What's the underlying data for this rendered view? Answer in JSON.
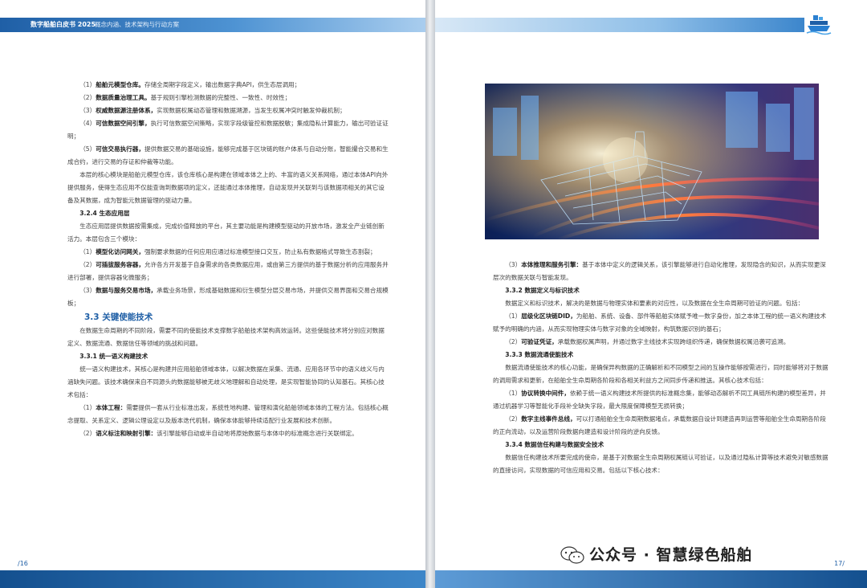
{
  "header": {
    "book_title": "数字船舶白皮书 2025",
    "chapter_title": "概念内涵、技术架构与行动方案"
  },
  "left_page": {
    "page_number": "16",
    "paragraphs": [
      {
        "num": "（1）",
        "bold": "船舶元模型仓库。",
        "text": "存储全周期字段定义，输出数据字典API，供生态层调用；"
      },
      {
        "num": "（2）",
        "bold": "数据质量治理工具。",
        "text": "基于规则引擎检测数据的完整性、一致性、时效性；"
      },
      {
        "num": "（3）",
        "bold": "权威数据源注册体系，",
        "text": "实现数据权属动态管理和数据溯源，当发生权属冲突时触发仲裁机制；"
      },
      {
        "num": "（4）",
        "bold": "可信数据空间引擎，",
        "text": "执行可信数据空间策略，实现字段级管控和数据脱敏；集成隐私计算能力，输出可验证证明；"
      },
      {
        "num": "（5）",
        "bold": "可信交易执行器，",
        "text": "提供数据交易的基础设施，能够完成基于区块链的账户体系与自动分账，智能撮合交易和生成合约，进行交易的存证和仲裁等功能。"
      }
    ],
    "core_module_para": "本层的核心模块是船舶元模型仓库，该仓库核心是构建在领域本体之上的、丰富的语义关系网络，通过本体API向外提供服务，使得生态应用不仅能查询到数据项的定义，还能通过本体推理，自动发现并关联到与该数据项相关的其它设备及其数据，成为智能元数据管理的驱动力量。",
    "s324_title": "3.2.4 生态应用层",
    "s324_intro": "生态应用层提供数据按需集成，完成价值释放的平台，其主要功能是构建模型驱动的开放市场，激发全产业链创新活力。本层包含三个模块：",
    "s324_items": [
      {
        "num": "（1）",
        "bold": "模型化访问网关，",
        "text": "强制要求数据的任何应用应通过标准模型接口交互，防止私有数据格式导致生态割裂；"
      },
      {
        "num": "（2）",
        "bold": "可插拔服务容器，",
        "text": "允许各方开发基于自身需求的各类数据应用，或由第三方提供的基于数据分析的应用服务并进行部署，提供容器化微服务；"
      },
      {
        "num": "（3）",
        "bold": "数据与服务交易市场，",
        "text": "承载业务场景，形成基础数据和衍生模型分层交易市场，并提供交易界面和交易合规模板；"
      }
    ],
    "s33_title": "3.3 关键使能技术",
    "s33_intro": "在数据生命周期的不同阶段，需要不同的使能技术支撑数字船舶技术架构高效运转。这些使能技术将分别应对数据定义、数据流通、数据信任等领域的挑战和问题。",
    "s331_title": "3.3.1 统一语义构建技术",
    "s331_intro": "统一语义构建技术，其核心是构建并应用船舶领域本体，以解决数据在采集、流通、应用各环节中的语义歧义与内涵缺失问题。该技术确保来自不同源头的数据能够被无歧义地理解和自动处理，是实现智能协同的认知基石。其核心技术包括：",
    "s331_items": [
      {
        "num": "（1）",
        "bold": "本体工程：",
        "text": "需要提供一套从行业标准出发，系统性地构建、管理和演化船舶领域本体的工程方法。包括核心概念提取、关系定义、逻辑公理设定以及版本迭代机制，确保本体能够持续适配行业发展和技术创新。"
      },
      {
        "num": "（2）",
        "bold": "语义标注和映射引擎：",
        "text": "该引擎能够自动或半自动地将原始数据与本体中的标准概念进行关联绑定。"
      }
    ]
  },
  "right_page": {
    "page_number": "17",
    "item3": {
      "num": "（3）",
      "bold": "本体推理和服务引擎：",
      "text": "基于本体中定义的逻辑关系，该引擎能够进行自动化推理，发现隐含的知识，从而实现更深层次的数据关联与智能发现。"
    },
    "s332_title": "3.3.2 数据定义与标识技术",
    "s332_intro": "数据定义和标识技术，解决的是数据与物理实体和要素的对应性，以及数据在全生命周期可验证的问题。包括：",
    "s332_items": [
      {
        "num": "（1）",
        "bold": "层级化区块链DID，",
        "text": "为船舶、系统、设备、部件等船舶实体赋予唯一数字身份，加之本体工程的统一语义构建技术赋予的明确的内涵，从而实现物理实体与数字对象的全域映射，构筑数据识别的基石；"
      },
      {
        "num": "（2）",
        "bold": "可验证凭证，",
        "text": "承载数据权属声明，并通过数字主线技术实现跨组织传递，确保数据权属沿袭可追溯。"
      }
    ],
    "s333_title": "3.3.3 数据流通使能技术",
    "s333_intro": "数据流通使能技术的核心功能，是确保异构数据的正确解析和不同模型之间的互操作能够按需进行，同时能够将对于数据的调用需求和更新，在船舶全生命周期各阶段和各相关利益方之间同步传递和推送。其核心技术包括：",
    "s333_items": [
      {
        "num": "（1）",
        "bold": "协议转换中间件，",
        "text": "依赖于统一语义构建技术所提供的标准概念集，能够动态解析不同工具链所构建的模型差异，并通过机器学习等智能化手段补全缺失字段，最大限度保障模型无损转换；"
      },
      {
        "num": "（2）",
        "bold": "数字主线事件总线，",
        "text": "可以打通船舶全生命周期数据堵点，承载数据自设计到建造再到运营等船舶全生命周期各阶段的正向流动，以及运营阶段数据向建造和设计阶段的逆向反馈。"
      }
    ],
    "s334_title": "3.3.4 数据信任构建与数据安全技术",
    "s334_intro": "数据信任构建技术所要完成的使命，是基于对数据全生命周期权属链认可验证，以及通过隐私计算等技术避免对敏感数据的直接访问，实现数据的可信应用和交易。包括以下核心技术：",
    "watermark": "公众号 · 智慧绿色船舶"
  }
}
